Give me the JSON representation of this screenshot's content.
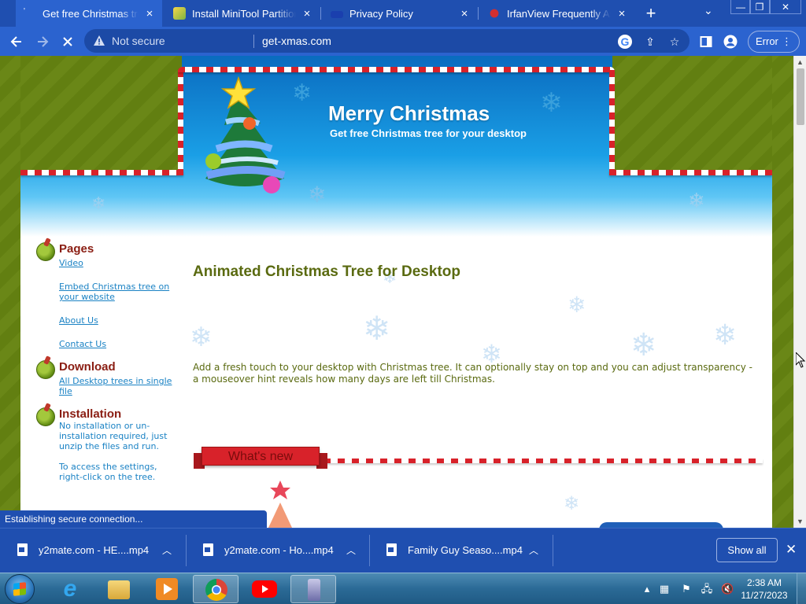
{
  "browser": {
    "tabs": [
      {
        "title": "Get free Christmas tree fo",
        "active": true
      },
      {
        "title": "Install MiniTool Partition W",
        "active": false
      },
      {
        "title": "Privacy Policy",
        "active": false
      },
      {
        "title": "IrfanView Frequently Aske",
        "active": false
      }
    ],
    "new_tab": "+",
    "close_glyph": "×",
    "tab_menu": "⌄",
    "window": {
      "minimize": "—",
      "restore": "❐",
      "close": "✕"
    },
    "security_label": "Not secure",
    "url": "get-xmas.com",
    "error_chip": "Error",
    "more_glyph": "⋮"
  },
  "site": {
    "header_title": "Merry Christmas",
    "header_subtitle": "Get free Christmas tree for your desktop",
    "sidebar": {
      "pages_title": "Pages",
      "pages_links": [
        "Video",
        "Embed Christmas tree on your website",
        "About Us",
        "Contact Us"
      ],
      "download_title": "Download",
      "download_link": "All Desktop trees in single file",
      "install_title": "Installation",
      "install_text1": "No installation or un-installation required, just unzip the files and run.",
      "install_text2": "To access the settings, right-click on the tree."
    },
    "main_heading": "Animated Christmas Tree for Desktop",
    "main_paragraph": "Add a fresh touch to your desktop with Christmas tree. It can optionally stay on top and you can adjust transparency - a mouseover hint reveals how many days are left till Christmas.",
    "whats_new": "What's new"
  },
  "status_text": "Establishing secure connection...",
  "downloads": {
    "items": [
      "y2mate.com - HE....mp4",
      "y2mate.com - Ho....mp4",
      "Family Guy Seaso....mp4"
    ],
    "show_all": "Show all",
    "close": "✕"
  },
  "taskbar": {
    "apps": [
      "internet-explorer",
      "file-explorer",
      "media-player",
      "chrome",
      "youtube",
      "installer"
    ],
    "time": "2:38 AM",
    "date": "11/27/2023"
  },
  "colors": {
    "chrome_blue": "#1f4fb0",
    "toolbar_blue": "#2b63cf",
    "olive": "#627f11",
    "candy_red": "#d8222a",
    "heading_olive": "#5a6a10",
    "section_red": "#8a1d12",
    "link_blue": "#1a82c4"
  }
}
